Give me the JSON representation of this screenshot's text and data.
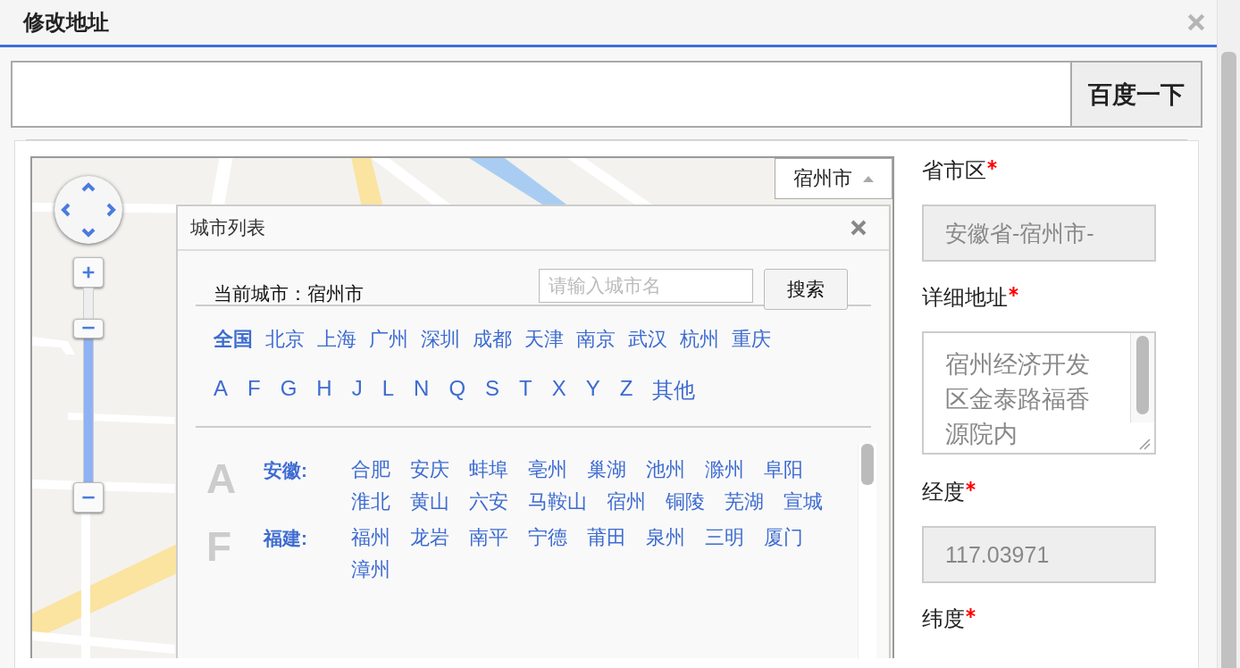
{
  "window": {
    "title": "修改地址"
  },
  "search": {
    "button": "百度一下"
  },
  "map": {
    "kind": "picture",
    "zoom": {
      "level": 0.79
    },
    "city_selector": {
      "label": "宿州市",
      "expanded": true
    }
  },
  "city_list": {
    "title": "城市列表",
    "current_city": "当前城市：宿州市",
    "search": {
      "placeholder": "请输入城市名",
      "button": "搜索"
    },
    "hot_cities": [
      {
        "label": "全国",
        "selected": true
      },
      {
        "label": "北京",
        "selected": false
      },
      {
        "label": "上海",
        "selected": false
      },
      {
        "label": "广州",
        "selected": false
      },
      {
        "label": "深圳",
        "selected": false
      },
      {
        "label": "成都",
        "selected": false
      },
      {
        "label": "天津",
        "selected": false
      },
      {
        "label": "南京",
        "selected": false
      },
      {
        "label": "武汉",
        "selected": false
      },
      {
        "label": "杭州",
        "selected": false
      },
      {
        "label": "重庆",
        "selected": false
      }
    ],
    "letters": [
      "A",
      "F",
      "G",
      "H",
      "J",
      "L",
      "N",
      "Q",
      "S",
      "T",
      "X",
      "Y",
      "Z",
      "其他"
    ],
    "groups": [
      {
        "letter": "A",
        "province": "安徽:",
        "cities": [
          "合肥",
          "安庆",
          "蚌埠",
          "亳州",
          "巢湖",
          "池州",
          "滁州",
          "阜阳",
          "淮北",
          "黄山",
          "六安",
          "马鞍山",
          "宿州",
          "铜陵",
          "芜湖",
          "宣城"
        ]
      },
      {
        "letter": "F",
        "province": "福建:",
        "cities": [
          "福州",
          "龙岩",
          "南平",
          "宁德",
          "莆田",
          "泉州",
          "三明",
          "厦门",
          "漳州"
        ]
      }
    ]
  },
  "form": {
    "fields": [
      {
        "label": "省市区",
        "required": true,
        "kind": "input",
        "disabled": true,
        "value": "安徽省-宿州市-"
      },
      {
        "label": "详细地址",
        "required": true,
        "kind": "textarea",
        "disabled": false,
        "value": "宿州经济开发区金泰路福香源院内"
      },
      {
        "label": "经度",
        "required": true,
        "kind": "input",
        "disabled": true,
        "value": "117.03971"
      },
      {
        "label": "纬度",
        "required": true,
        "kind": "none"
      }
    ]
  }
}
